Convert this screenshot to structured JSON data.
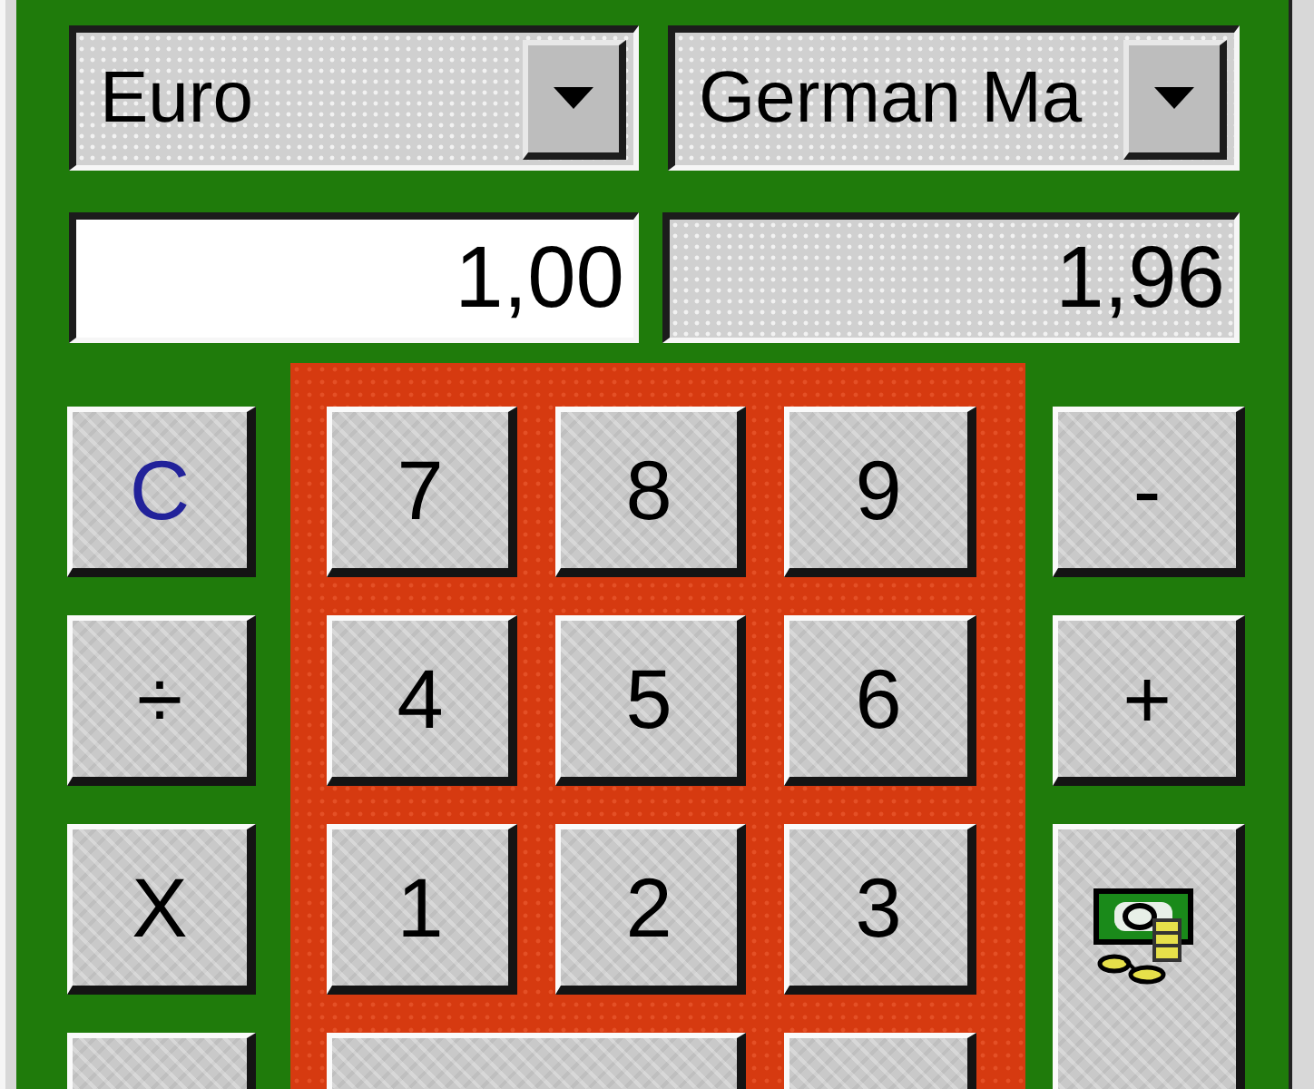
{
  "currency_selectors": [
    {
      "value": "Euro"
    },
    {
      "value": "German Ma"
    }
  ],
  "amount_field": {
    "value": "1,00"
  },
  "result_field": {
    "value": "1,96"
  },
  "keypad": {
    "left_keys": [
      {
        "label": "C",
        "kind": "clear"
      },
      {
        "label": "÷",
        "kind": "key"
      },
      {
        "label": "X",
        "kind": "key"
      },
      {
        "kind": "key"
      }
    ],
    "digit_keys": [
      {
        "label": "7",
        "kind": "key"
      },
      {
        "label": "8",
        "kind": "key"
      },
      {
        "label": "9",
        "kind": "key"
      },
      {
        "label": "4",
        "kind": "key"
      },
      {
        "label": "5",
        "kind": "key"
      },
      {
        "label": "6",
        "kind": "key"
      },
      {
        "label": "1",
        "kind": "key"
      },
      {
        "label": "2",
        "kind": "key"
      },
      {
        "label": "3",
        "kind": "key"
      },
      {
        "kind": "wide"
      },
      {
        "kind": "key"
      }
    ],
    "right_keys": [
      {
        "label": "-",
        "kind": "key"
      },
      {
        "label": "+",
        "kind": "key"
      },
      {
        "kind": "convert"
      }
    ]
  }
}
